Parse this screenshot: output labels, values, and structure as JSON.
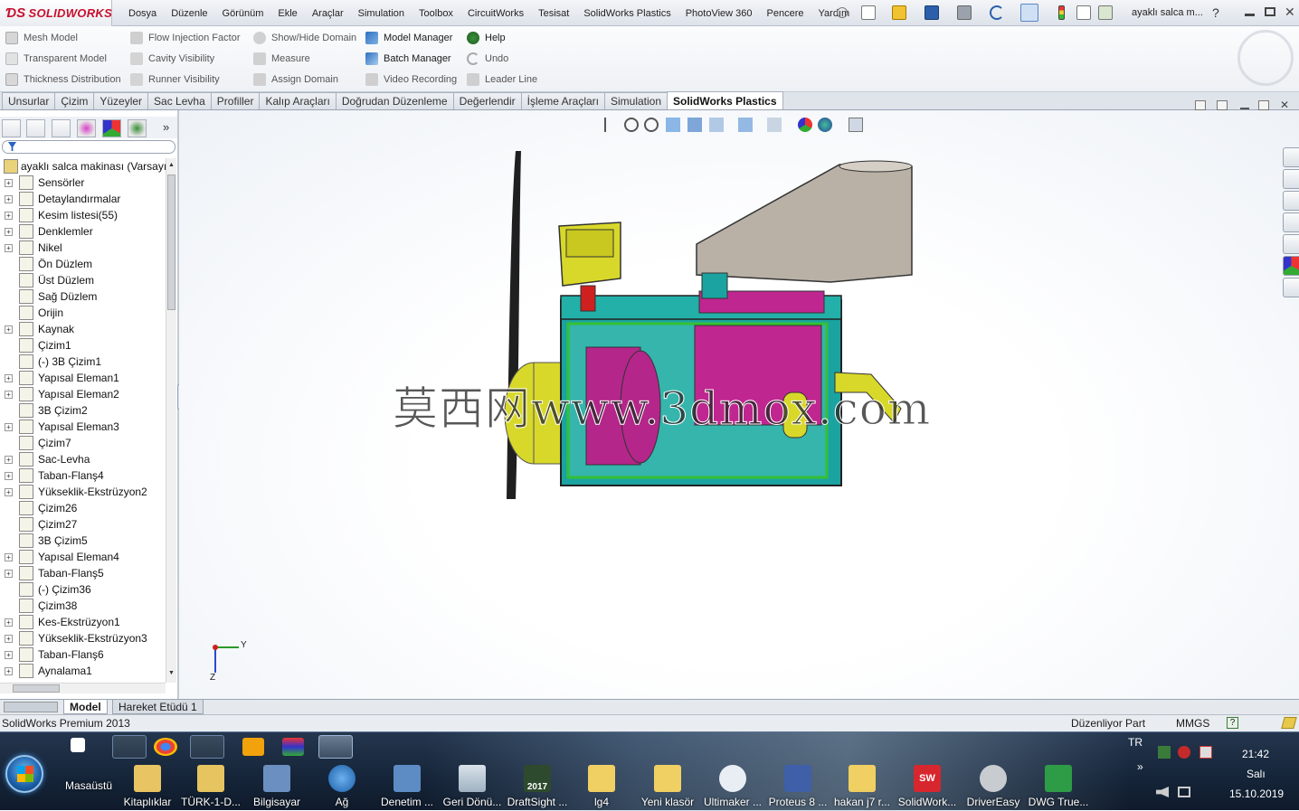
{
  "app": {
    "logo": "SOLIDWORKS",
    "document_title": "ayaklı salca m...",
    "help_mark": "?"
  },
  "menu": [
    "Dosya",
    "Düzenle",
    "Görünüm",
    "Ekle",
    "Araçlar",
    "Simulation",
    "Toolbox",
    "CircuitWorks",
    "Tesisat",
    "SolidWorks Plastics",
    "PhotoView 360",
    "Pencere",
    "Yardım"
  ],
  "commands": {
    "col1": [
      "Mesh Model",
      "Transparent Model",
      "Thickness Distribution"
    ],
    "col2": [
      "Flow Injection Factor",
      "Cavity Visibility",
      "Runner Visibility"
    ],
    "col3": [
      "Show/Hide Domain",
      "Measure",
      "Assign Domain"
    ],
    "col4": [
      "Model Manager",
      "Batch Manager",
      "Video Recording"
    ],
    "col5": [
      "Help",
      "Undo",
      "Leader Line"
    ]
  },
  "tabs": [
    "Unsurlar",
    "Çizim",
    "Yüzeyler",
    "Sac Levha",
    "Profiller",
    "Kalıp Araçları",
    "Doğrudan Düzenleme",
    "Değerlendir",
    "İşleme Araçları",
    "Simulation",
    "SolidWorks Plastics"
  ],
  "active_tab": "SolidWorks Plastics",
  "tree": {
    "root": "ayaklı salca makinası  (Varsayı",
    "items": [
      "Sensörler",
      "Detaylandırmalar",
      "Kesim listesi(55)",
      "Denklemler",
      "Nikel",
      "Ön Düzlem",
      "Üst Düzlem",
      "Sağ Düzlem",
      "Orijin",
      "Kaynak",
      "Çizim1",
      "(-) 3B Çizim1",
      "Yapısal Eleman1",
      "Yapısal Eleman2",
      "3B Çizim2",
      "Yapısal Eleman3",
      "Çizim7",
      "Sac-Levha",
      "Taban-Flanş4",
      "Yükseklik-Ekstrüzyon2",
      "Çizim26",
      "Çizim27",
      "3B Çizim5",
      "Yapısal Eleman4",
      "Taban-Flanş5",
      "(-) Çizim36",
      "Çizim38",
      "Kes-Ekstrüzyon1",
      "Yükseklik-Ekstrüzyon3",
      "Taban-Flanş6",
      "Aynalama1"
    ]
  },
  "viewport": {
    "watermark": "莫西网www.3dmox.com",
    "axis_y": "Y",
    "axis_z": "Z"
  },
  "bottom_tabs": [
    "Model",
    "Hareket Etüdü 1"
  ],
  "status": {
    "left": "SolidWorks Premium 2013",
    "mode": "Düzenliyor Part",
    "units": "MMGS",
    "help": "?"
  },
  "taskbar": {
    "desktop": "Masaüstü",
    "buttons": [
      "Kitaplıklar",
      "TÜRK-1-D...",
      "Bilgisayar",
      "Ağ",
      "Denetim ...",
      "Geri Dönü...",
      "DraftSight ...",
      "lg4",
      "Yeni klasör",
      "Ultimaker ...",
      "Proteus 8 ...",
      "hakan j7 r...",
      "SolidWork...",
      "DriverEasy",
      "DWG True..."
    ],
    "draftsight_year": "2017",
    "lang": "TR",
    "time": "21:42",
    "day": "Salı",
    "date": "15.10.2019"
  },
  "colors": {
    "frame": "#1aa3a0",
    "motor": "#c0268f",
    "yellow": "#d8d82a",
    "hopper": "#b9b1a6",
    "red": "#d01f1f"
  }
}
